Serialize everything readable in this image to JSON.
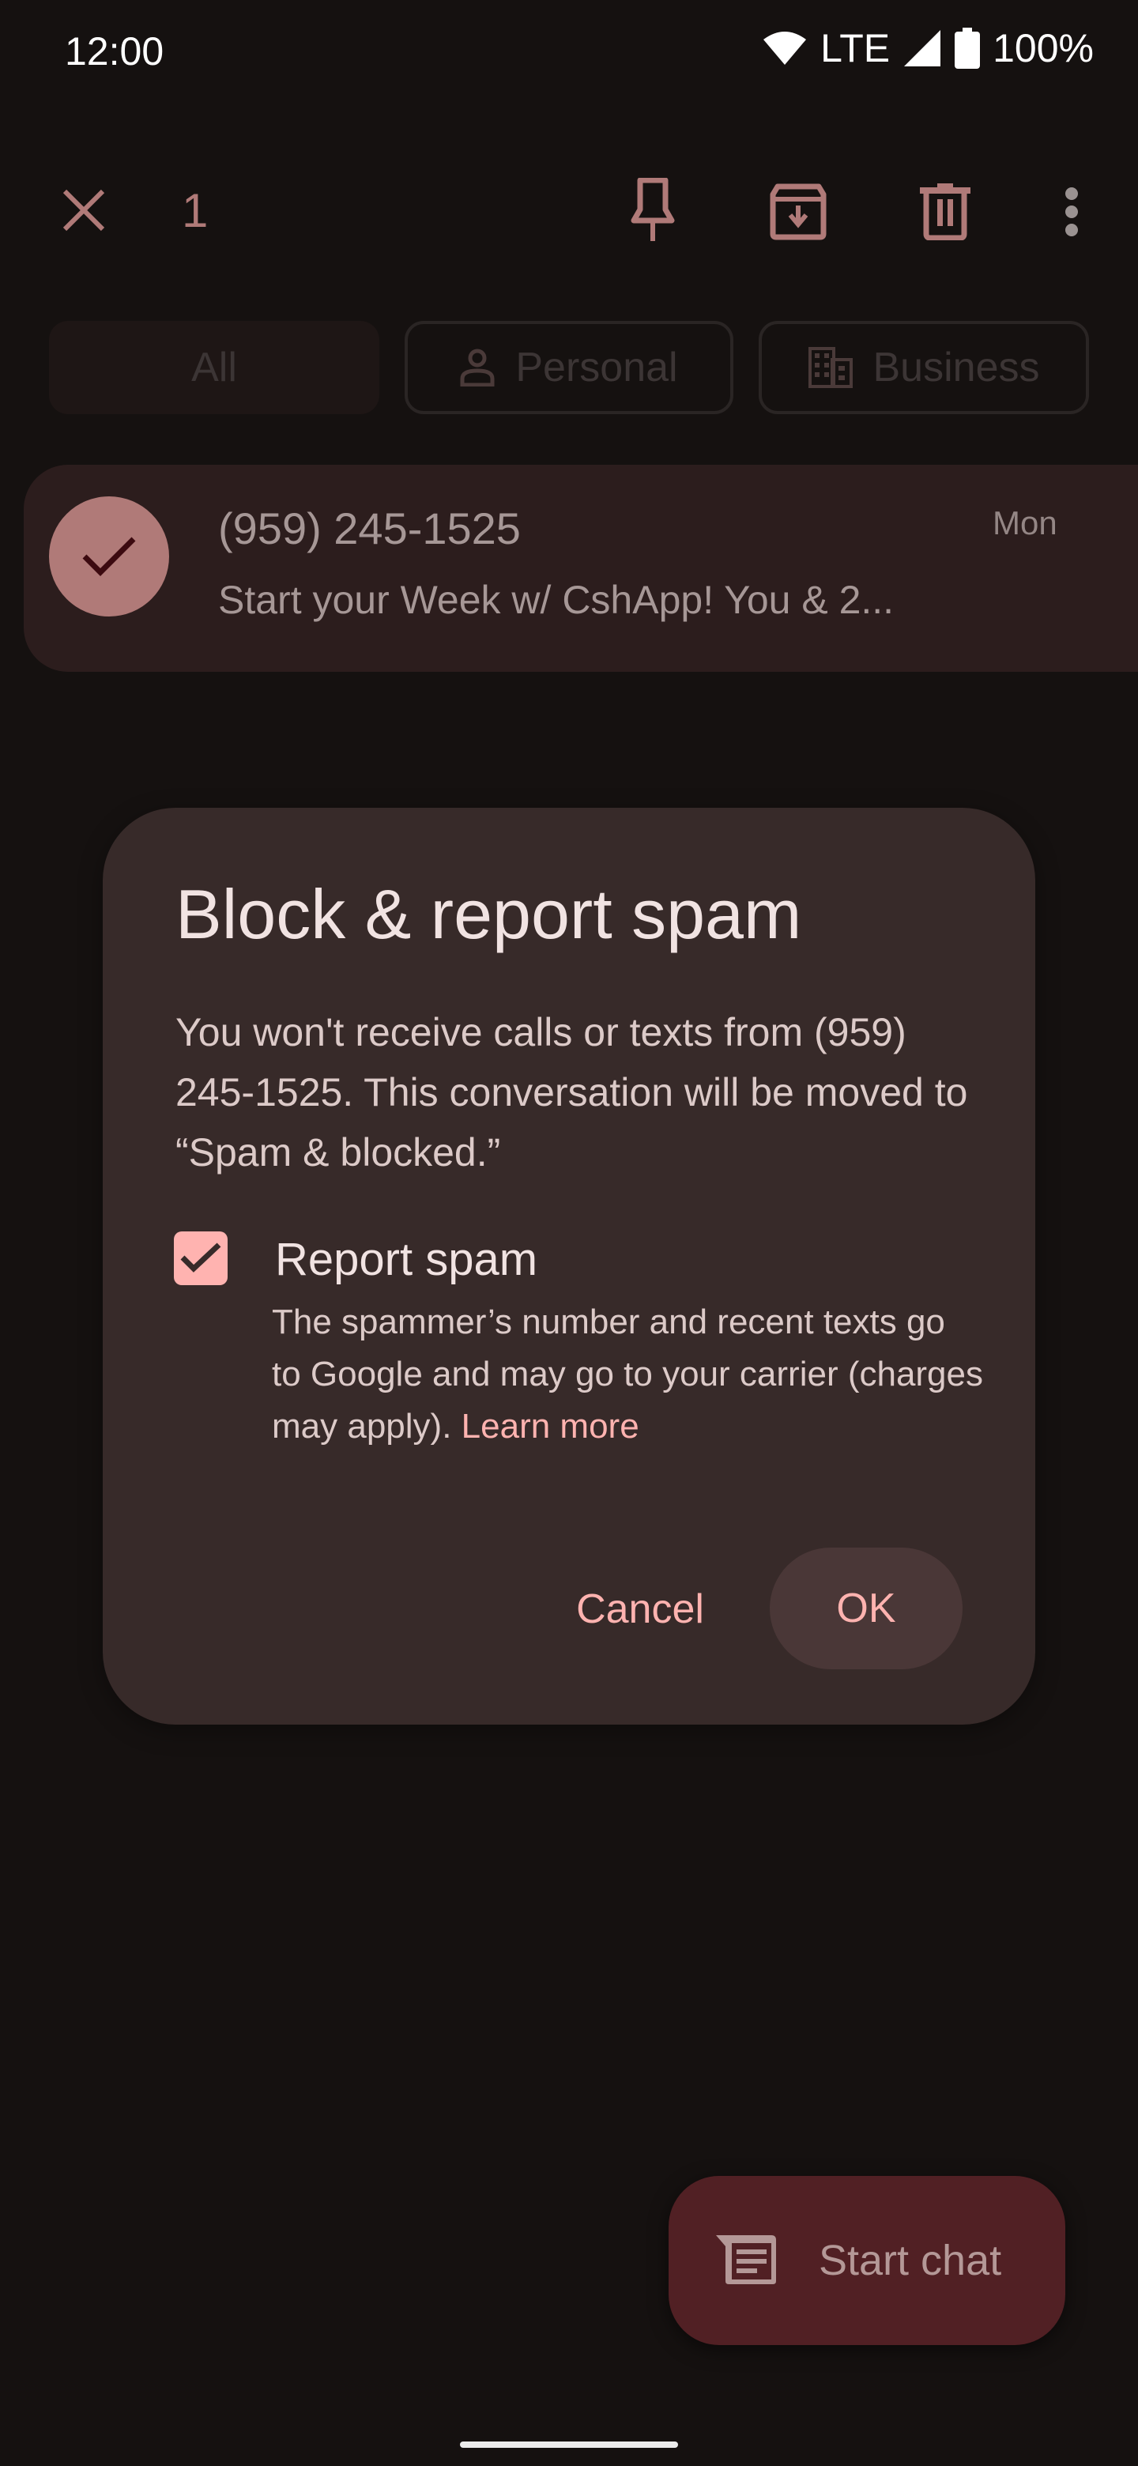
{
  "status_bar": {
    "time": "12:00",
    "network": "LTE",
    "battery": "100%",
    "icons": [
      "wifi-icon",
      "cell-signal-icon",
      "battery-icon"
    ]
  },
  "action_bar": {
    "selected_count": "1",
    "icons": [
      "close-icon",
      "pin-icon",
      "archive-icon",
      "delete-icon",
      "more-vert-icon"
    ]
  },
  "filter_chips": [
    {
      "label": "All",
      "icon": null,
      "selected": true
    },
    {
      "label": "Personal",
      "icon": "person-icon",
      "selected": false
    },
    {
      "label": "Business",
      "icon": "business-icon",
      "selected": false
    }
  ],
  "conversations": [
    {
      "name": "(959) 245-1525",
      "snippet": "Start your Week w/ CshApp! You & 2...",
      "time": "Mon",
      "selected": true
    }
  ],
  "dialog": {
    "title": "Block & report spam",
    "body": "You won't receive calls or texts from (959) 245-1525. This conversation will be moved to “Spam & blocked.”",
    "checkbox": {
      "label": "Report spam",
      "checked": true,
      "description": "The spammer’s number and recent texts go to Google and may go to your carrier (charges may apply).",
      "link": "Learn more"
    },
    "cancel_label": "Cancel",
    "ok_label": "OK"
  },
  "fab": {
    "label": "Start chat",
    "icon": "message-icon"
  },
  "colors": {
    "background": "#151110",
    "accent": "#ffb3b0",
    "icon_tint": "#b07a78",
    "dialog_bg": "#372a29",
    "fab_bg": "#512024"
  }
}
